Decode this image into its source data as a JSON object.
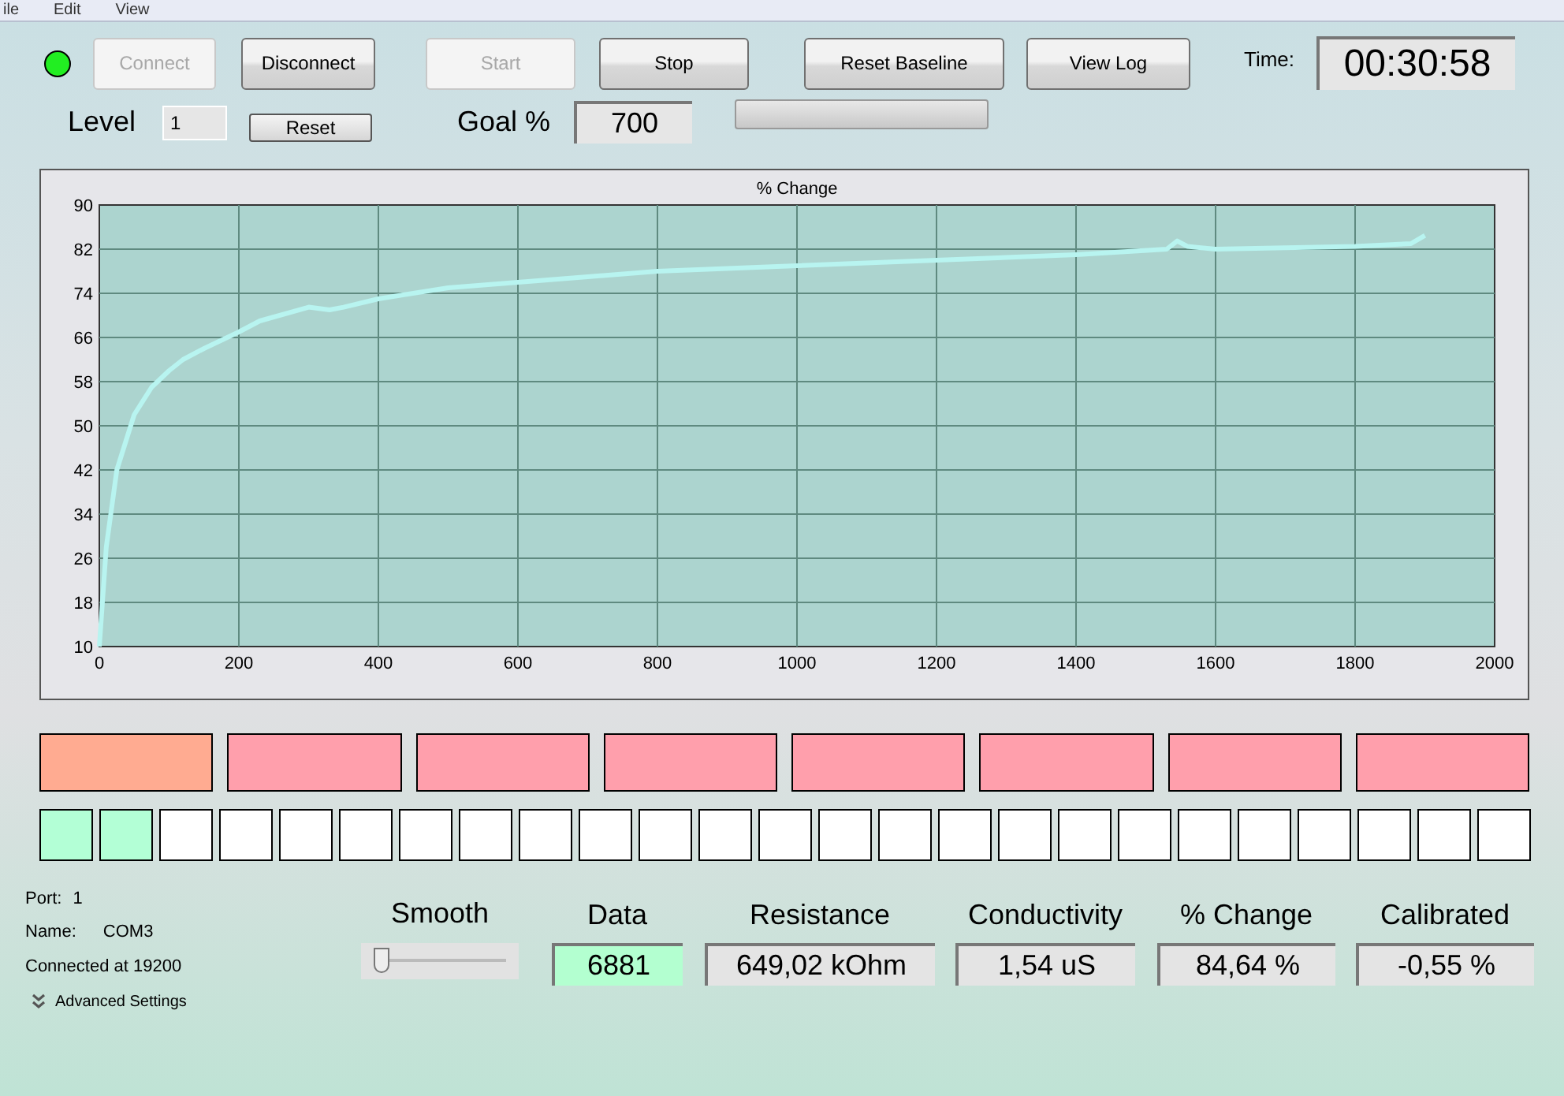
{
  "menu": [
    "ile",
    "Edit",
    "View"
  ],
  "status_light": {
    "on": true
  },
  "buttons": [
    {
      "label": "Connect",
      "disabled": true
    },
    {
      "label": "Disconnect",
      "disabled": false
    },
    {
      "label": "Start",
      "disabled": true
    },
    {
      "label": "Stop",
      "disabled": false
    },
    {
      "label": "Reset Baseline",
      "disabled": false
    },
    {
      "label": "View Log",
      "disabled": false
    }
  ],
  "time": {
    "label": "Time:",
    "value": "00:30:58"
  },
  "level": {
    "label": "Level",
    "value": "1",
    "reset": "Reset"
  },
  "goal": {
    "label": "Goal %",
    "value": "700",
    "progress": {
      "level": 0
    }
  },
  "chart_data": {
    "type": "line",
    "title": "% Change",
    "xlim": [
      0,
      2000
    ],
    "ylim": [
      10,
      90
    ],
    "xticks": [
      0,
      200,
      400,
      600,
      800,
      1000,
      1200,
      1400,
      1600,
      1800,
      2000
    ],
    "yticks": [
      10,
      18,
      26,
      34,
      42,
      50,
      58,
      66,
      74,
      82,
      90
    ],
    "grid": true,
    "series": [
      {
        "color": "#b8f4f0",
        "x": [
          0,
          10,
          25,
          50,
          75,
          100,
          120,
          150,
          200,
          230,
          300,
          330,
          350,
          400,
          500,
          600,
          700,
          800,
          1000,
          1200,
          1400,
          1530,
          1545,
          1560,
          1600,
          1800,
          1880,
          1900
        ],
        "values": [
          10,
          28,
          42,
          52,
          57,
          60,
          62,
          64,
          67,
          69,
          71.5,
          71,
          71.5,
          73,
          75,
          76,
          77,
          78,
          79,
          80,
          81,
          82,
          83.5,
          82.5,
          82,
          82.5,
          83,
          84.5
        ]
      }
    ]
  },
  "indicators": [
    {
      "color": "#ffab91"
    },
    {
      "color": "#ff9fac"
    },
    {
      "color": "#ff9fac"
    },
    {
      "color": "#ff9fac"
    },
    {
      "color": "#ff9fac"
    },
    {
      "color": "#ff9fac"
    },
    {
      "color": "#ff9fac"
    },
    {
      "color": "#ff9fac"
    }
  ],
  "cells": [
    {
      "color": "#b3ffd6"
    },
    {
      "color": "#b3ffd6"
    },
    {
      "color": "#ffffff"
    },
    {
      "color": "#ffffff"
    },
    {
      "color": "#ffffff"
    },
    {
      "color": "#ffffff"
    },
    {
      "color": "#ffffff"
    },
    {
      "color": "#ffffff"
    },
    {
      "color": "#ffffff"
    },
    {
      "color": "#ffffff"
    },
    {
      "color": "#ffffff"
    },
    {
      "color": "#ffffff"
    },
    {
      "color": "#ffffff"
    },
    {
      "color": "#ffffff"
    },
    {
      "color": "#ffffff"
    },
    {
      "color": "#ffffff"
    },
    {
      "color": "#ffffff"
    },
    {
      "color": "#ffffff"
    },
    {
      "color": "#ffffff"
    },
    {
      "color": "#ffffff"
    },
    {
      "color": "#ffffff"
    },
    {
      "color": "#ffffff"
    },
    {
      "color": "#ffffff"
    },
    {
      "color": "#ffffff"
    },
    {
      "color": "#ffffff"
    }
  ],
  "connection": {
    "port_label": "Port:",
    "port": "1",
    "name_label": "Name:",
    "name": "COM3",
    "status": "Connected at 19200",
    "advanced": "Advanced Settings"
  },
  "smooth": {
    "label": "Smooth",
    "level": 0.05
  },
  "readouts": [
    {
      "label": "Data",
      "value": "6881",
      "highlight": true
    },
    {
      "label": "Resistance",
      "value": "649,02 kOhm",
      "highlight": false
    },
    {
      "label": "Conductivity",
      "value": "1,54 uS",
      "highlight": false
    },
    {
      "label": "% Change",
      "value": "84,64 %",
      "highlight": false
    },
    {
      "label": "Calibrated",
      "value": "-0,55 %",
      "highlight": false
    }
  ]
}
